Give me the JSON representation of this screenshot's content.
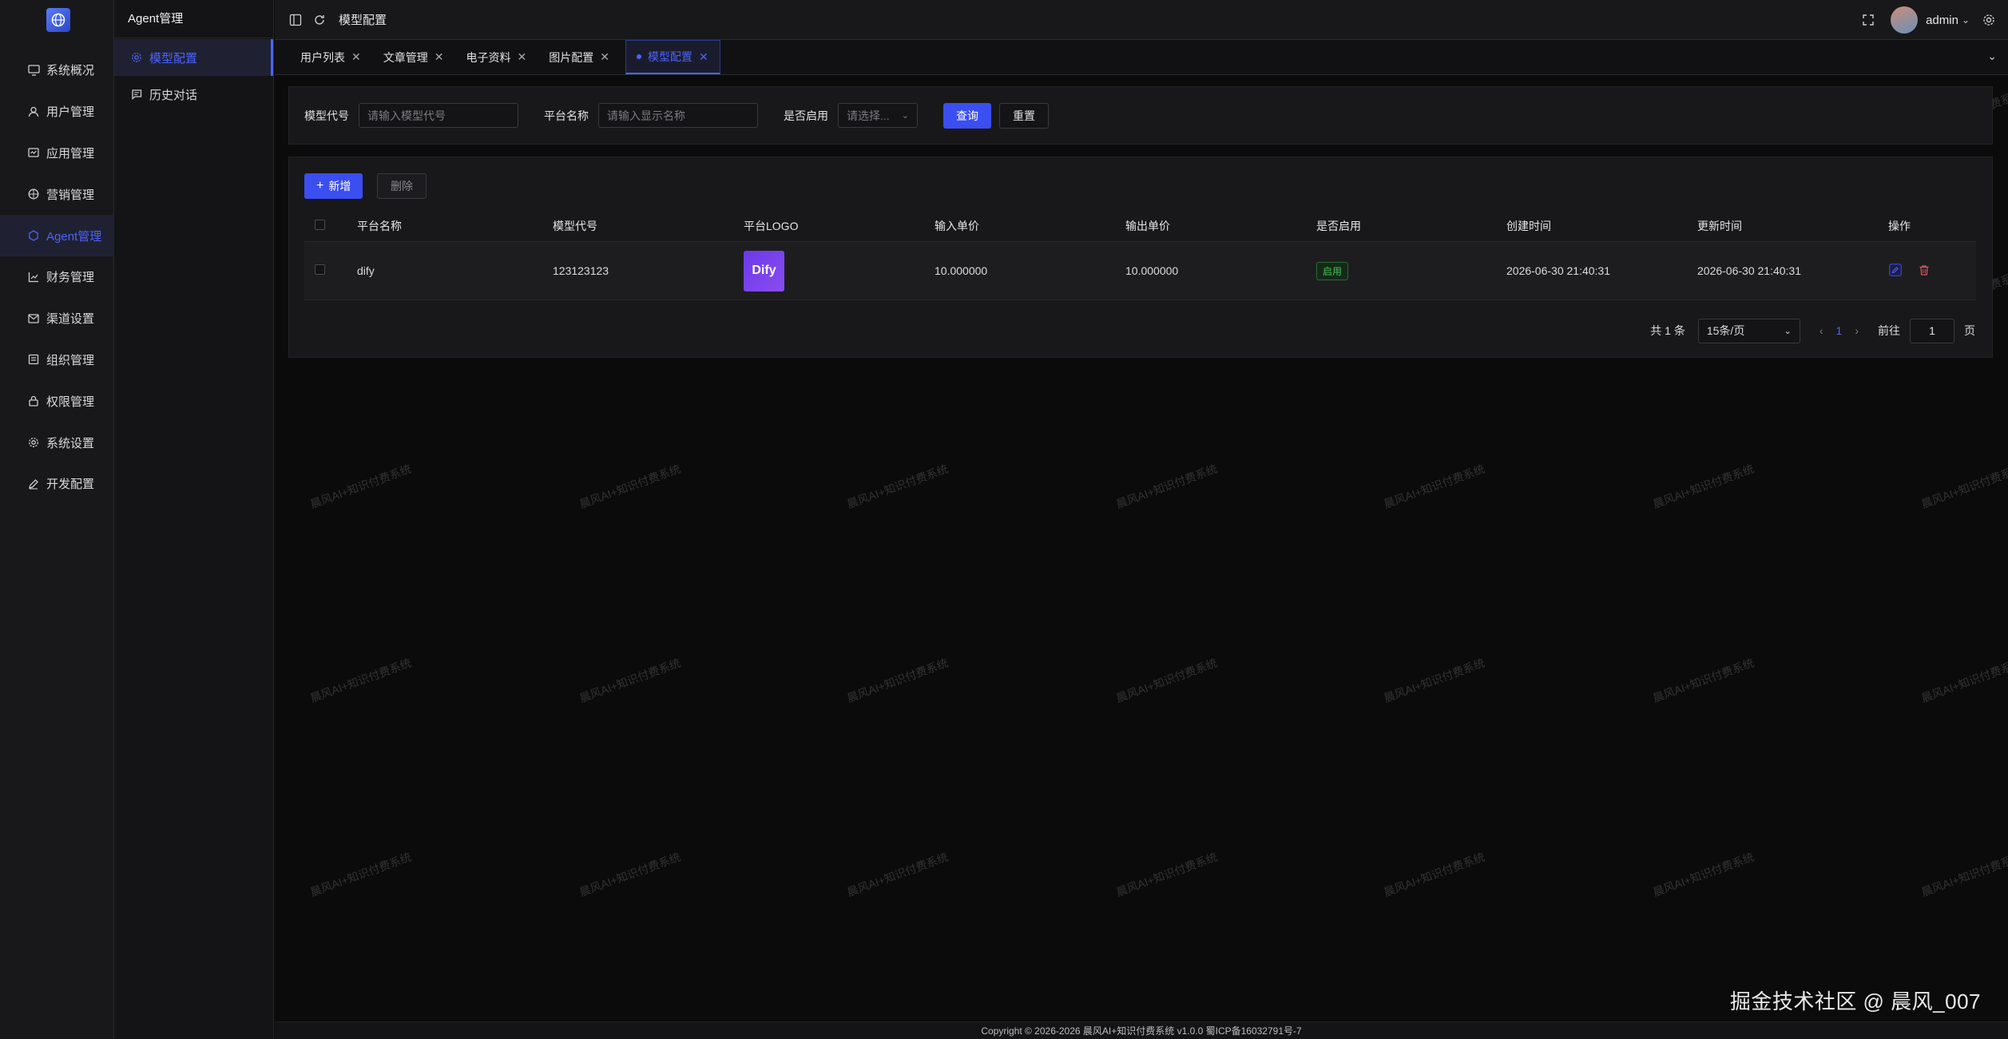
{
  "brand": {
    "logo_icon": "globe-logo-icon"
  },
  "nav_main": [
    {
      "label": "系统概况",
      "icon": "monitor-icon"
    },
    {
      "label": "用户管理",
      "icon": "user-icon"
    },
    {
      "label": "应用管理",
      "icon": "app-icon"
    },
    {
      "label": "营销管理",
      "icon": "marketing-icon"
    },
    {
      "label": "Agent管理",
      "icon": "agent-icon",
      "active": true
    },
    {
      "label": "财务管理",
      "icon": "chart-icon"
    },
    {
      "label": "渠道设置",
      "icon": "mail-icon"
    },
    {
      "label": "组织管理",
      "icon": "org-icon"
    },
    {
      "label": "权限管理",
      "icon": "lock-icon"
    },
    {
      "label": "系统设置",
      "icon": "gear-icon"
    },
    {
      "label": "开发配置",
      "icon": "pen-icon"
    }
  ],
  "sub_nav": {
    "title": "Agent管理",
    "items": [
      {
        "label": "模型配置",
        "icon": "gear-icon",
        "active": true
      },
      {
        "label": "历史对话",
        "icon": "chat-icon"
      }
    ]
  },
  "topbar": {
    "breadcrumb": "模型配置",
    "username": "admin"
  },
  "tabs": [
    {
      "label": "用户列表"
    },
    {
      "label": "文章管理"
    },
    {
      "label": "电子资料"
    },
    {
      "label": "图片配置"
    },
    {
      "label": "模型配置",
      "active": true
    }
  ],
  "search": {
    "model_code_label": "模型代号",
    "model_code_placeholder": "请输入模型代号",
    "platform_label": "平台名称",
    "platform_placeholder": "请输入显示名称",
    "enabled_label": "是否启用",
    "enabled_placeholder": "请选择...",
    "query_button": "查询",
    "reset_button": "重置"
  },
  "toolbar": {
    "add_button": "新增",
    "delete_button": "删除"
  },
  "table": {
    "headers": [
      "平台名称",
      "模型代号",
      "平台LOGO",
      "输入单价",
      "输出单价",
      "是否启用",
      "创建时间",
      "更新时间",
      "操作"
    ],
    "rows": [
      {
        "platform": "dify",
        "model_code": "123123123",
        "logo_text": "Dify",
        "input_price": "10.000000",
        "output_price": "10.000000",
        "enabled": "启用",
        "created": "2026-06-30 21:40:31",
        "updated": "2026-06-30 21:40:31"
      }
    ]
  },
  "pagination": {
    "total": "共 1 条",
    "page_size": "15条/页",
    "current": "1",
    "goto_label": "前往",
    "goto_value": "1",
    "page_suffix": "页"
  },
  "footer": {
    "copyright": "Copyright © 2026-2026 晨风AI+知识付费系统 v1.0.0  蜀ICP备16032791号-7"
  },
  "watermark": {
    "text": "晨风AI+知识付费系统",
    "corner": "掘金技术社区 @ 晨风_007"
  },
  "colors": {
    "accent": "#3b4ef0",
    "active_text": "#4d63f5",
    "success": "#4cc15a",
    "danger": "#e05a5a",
    "background": "#0b0b0c"
  }
}
